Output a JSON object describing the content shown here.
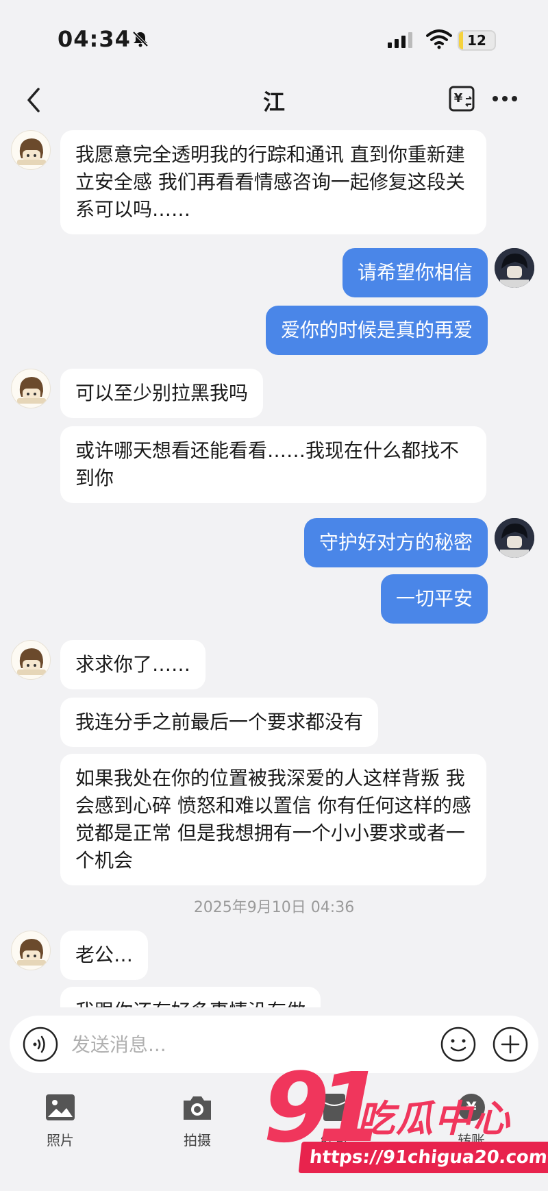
{
  "status_bar": {
    "time": "04:34",
    "battery_level": "12",
    "battery_fraction": 0.12
  },
  "header": {
    "title": "江"
  },
  "messages": [
    {
      "text": "我愿意完全透明我的行踪和通讯 直到你重新建立安全感 我们再看看情感咨询一起修复这段关系可以吗……"
    },
    {
      "text": "请希望你相信"
    },
    {
      "text": "爱你的时候是真的再爱"
    },
    {
      "text": "可以至少别拉黑我吗"
    },
    {
      "text": "或许哪天想看还能看看……我现在什么都找不到你"
    },
    {
      "text": "守护好对方的秘密"
    },
    {
      "text": "一切平安"
    },
    {
      "text": "求求你了……"
    },
    {
      "text": "我连分手之前最后一个要求都没有"
    },
    {
      "text": "如果我处在你的位置被我深爱的人这样背叛 我会感到心碎 愤怒和难以置信 你有任何这样的感觉都是正常 但是我想拥有一个小小要求或者一个机会"
    },
    {
      "text": "老公…"
    },
    {
      "text": "我跟你还有好多事情没有做"
    }
  ],
  "timestamp": "2025年9月10日 04:36",
  "input": {
    "placeholder": "发送消息..."
  },
  "toolbar": {
    "photo_label": "照片",
    "camera_label": "拍摄",
    "redpacket_label": "红包",
    "transfer_label": "转账"
  },
  "watermark": {
    "number": "91",
    "name": "吃瓜中心",
    "url": "https://91chigua20.com"
  },
  "colors": {
    "outgoing_bubble": "#4a86e8",
    "incoming_bubble": "#ffffff",
    "background": "#f2f2f4",
    "watermark": "#f0365c"
  }
}
